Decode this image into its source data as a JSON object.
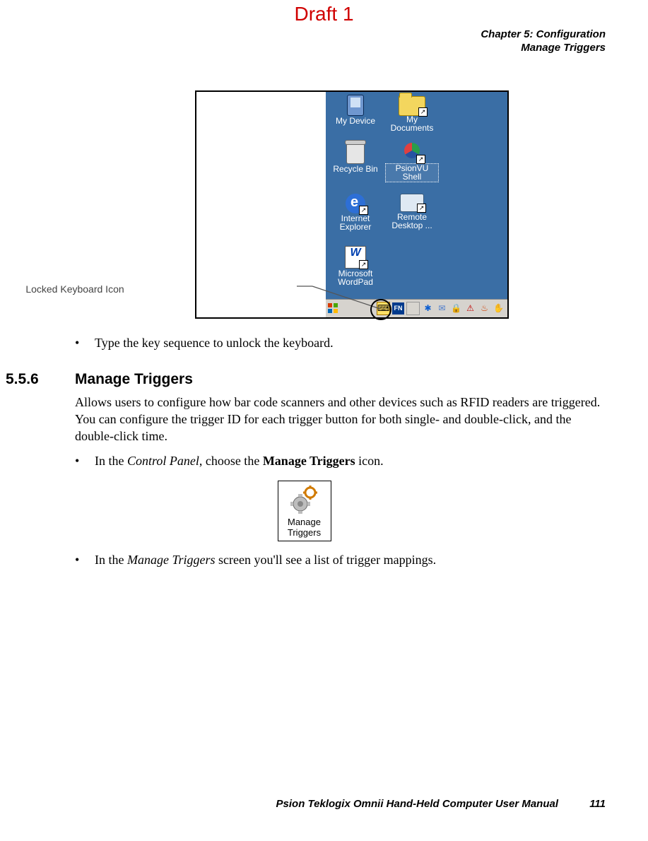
{
  "draft_label": "Draft 1",
  "chapter_header": {
    "line1": "Chapter 5: Configuration",
    "line2": "Manage Triggers"
  },
  "figure": {
    "callout": "Locked Keyboard Icon",
    "desktop_icons": [
      {
        "label": "My Device"
      },
      {
        "label": "My Documents"
      },
      {
        "label": "Recycle Bin"
      },
      {
        "label": "PsionVU Shell"
      },
      {
        "label": "Internet Explorer"
      },
      {
        "label": "Remote Desktop ..."
      },
      {
        "label": "Microsoft WordPad"
      }
    ]
  },
  "bullets": {
    "b1": "Type the key sequence to unlock the keyboard.",
    "b2_prefix": "In the ",
    "b2_em": "Control Panel",
    "b2_mid": ", choose the ",
    "b2_strong": "Manage Triggers",
    "b2_suffix": " icon.",
    "b3_prefix": "In the ",
    "b3_em": "Manage Triggers",
    "b3_suffix": " screen you'll see a list of trigger mappings."
  },
  "section": {
    "number": "5.5.6",
    "title": "Manage Triggers",
    "paragraph": "Allows users to configure how bar code scanners and other devices such as RFID readers are triggered. You can configure the trigger ID for each trigger button for both single- and double-click, and the double-click time."
  },
  "manage_icon_label": "Manage Triggers",
  "footer": {
    "book": "Psion Teklogix Omnii Hand-Held Computer User Manual",
    "page": "111"
  }
}
